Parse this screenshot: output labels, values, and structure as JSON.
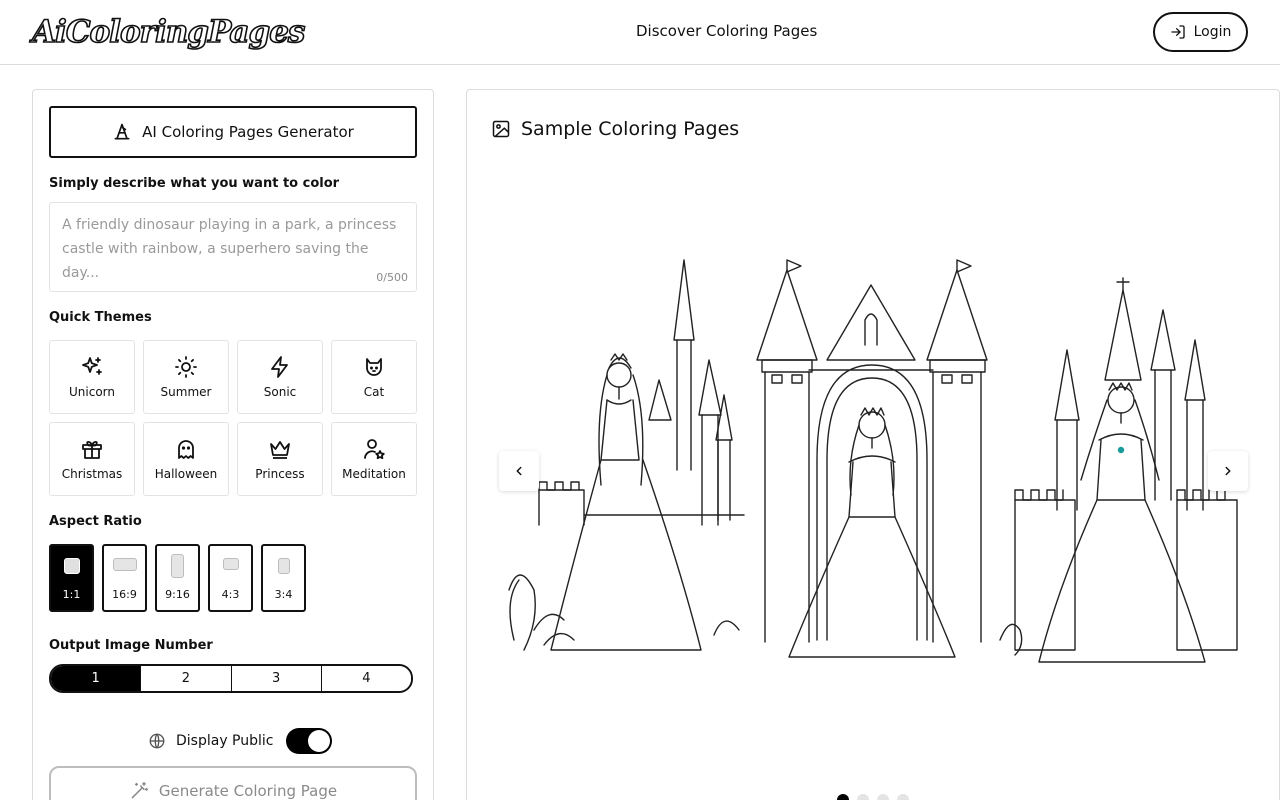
{
  "header": {
    "logo": "AiColoringPages",
    "nav_discover": "Discover Coloring Pages",
    "login_label": "Login"
  },
  "generator": {
    "title": "AI Coloring Pages Generator",
    "describe_label": "Simply describe what you want to color",
    "prompt_placeholder": "A friendly dinosaur playing in a park, a princess castle with rainbow, a superhero saving the day...",
    "prompt_value": "",
    "char_counter": "0/500",
    "themes_label": "Quick Themes",
    "themes": [
      {
        "label": "Unicorn",
        "icon": "sparkles-icon"
      },
      {
        "label": "Summer",
        "icon": "sun-icon"
      },
      {
        "label": "Sonic",
        "icon": "lightning-icon"
      },
      {
        "label": "Cat",
        "icon": "cat-icon"
      },
      {
        "label": "Christmas",
        "icon": "gift-icon"
      },
      {
        "label": "Halloween",
        "icon": "ghost-icon"
      },
      {
        "label": "Princess",
        "icon": "crown-icon"
      },
      {
        "label": "Meditation",
        "icon": "person-star-icon"
      }
    ],
    "aspect_label": "Aspect Ratio",
    "aspect_ratios": [
      "1:1",
      "16:9",
      "9:16",
      "4:3",
      "3:4"
    ],
    "aspect_selected": "1:1",
    "output_label": "Output Image Number",
    "output_options": [
      "1",
      "2",
      "3",
      "4"
    ],
    "output_selected": "1",
    "public_label": "Display Public",
    "public_on": true,
    "generate_label": "Generate Coloring Page"
  },
  "samples": {
    "title": "Sample Coloring Pages",
    "slides": [
      "princess-castle-left",
      "princess-arch-center",
      "princess-castle-right"
    ],
    "dots_count": 4,
    "active_dot": 1
  }
}
